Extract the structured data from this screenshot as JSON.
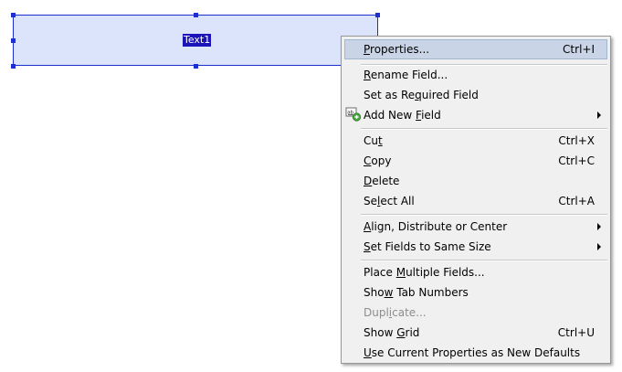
{
  "field": {
    "label": "Text1",
    "fill_color": "#dce4fc",
    "border_color": "#1c2fd0"
  },
  "context_menu": {
    "items": [
      {
        "id": "properties",
        "pre": "",
        "key": "P",
        "post": "roperties...",
        "shortcut": "Ctrl+I",
        "highlighted": true
      },
      {
        "id": "rename-field",
        "pre": "",
        "key": "R",
        "post": "ename Field...",
        "shortcut": ""
      },
      {
        "id": "set-required",
        "pre": "Set as Re",
        "key": "q",
        "post": "uired Field",
        "shortcut": ""
      },
      {
        "id": "add-new-field",
        "pre": "Add New ",
        "key": "F",
        "post": "ield",
        "shortcut": "",
        "submenu": true,
        "icon": "add-field-icon"
      },
      {
        "id": "cut",
        "pre": "Cu",
        "key": "t",
        "post": "",
        "shortcut": "Ctrl+X"
      },
      {
        "id": "copy",
        "pre": "",
        "key": "C",
        "post": "opy",
        "shortcut": "Ctrl+C"
      },
      {
        "id": "delete",
        "pre": "",
        "key": "D",
        "post": "elete",
        "shortcut": ""
      },
      {
        "id": "select-all",
        "pre": "Se",
        "key": "l",
        "post": "ect All",
        "shortcut": "Ctrl+A"
      },
      {
        "id": "align-distribute",
        "pre": "",
        "key": "A",
        "post": "lign, Distribute or Center",
        "shortcut": "",
        "submenu": true
      },
      {
        "id": "same-size",
        "pre": "",
        "key": "S",
        "post": "et Fields to Same Size",
        "shortcut": "",
        "submenu": true
      },
      {
        "id": "place-multiple",
        "pre": "Place ",
        "key": "M",
        "post": "ultiple Fields...",
        "shortcut": ""
      },
      {
        "id": "show-tab-numbers",
        "pre": "Sho",
        "key": "w",
        "post": " Tab Numbers",
        "shortcut": ""
      },
      {
        "id": "duplicate",
        "pre": "Dupl",
        "key": "i",
        "post": "cate...",
        "shortcut": "",
        "disabled": true
      },
      {
        "id": "show-grid",
        "pre": "Show ",
        "key": "G",
        "post": "rid",
        "shortcut": "Ctrl+U"
      },
      {
        "id": "use-defaults",
        "pre": "",
        "key": "U",
        "post": "se Current Properties as New Defaults",
        "shortcut": ""
      }
    ],
    "highlight_color": "#c9d5e6",
    "background_color": "#f0f0f0"
  }
}
